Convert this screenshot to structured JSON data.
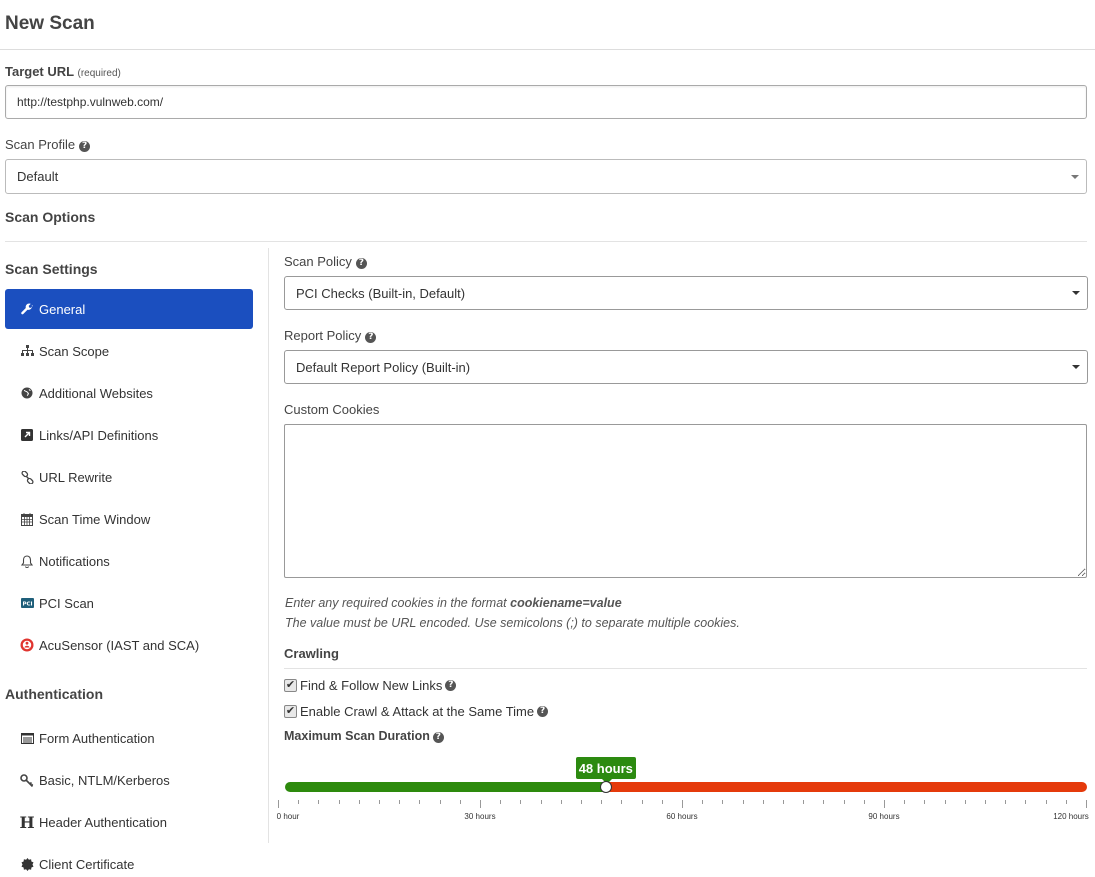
{
  "page": {
    "title": "New Scan"
  },
  "target_url": {
    "label": "Target URL",
    "required": "(required)",
    "value": "http://testphp.vulnweb.com/"
  },
  "scan_profile": {
    "label": "Scan Profile",
    "value": "Default"
  },
  "scan_options": {
    "title": "Scan Options"
  },
  "sidebar": {
    "settings_title": "Scan Settings",
    "items": [
      {
        "label": "General",
        "icon": "wrench-icon",
        "active": true
      },
      {
        "label": "Scan Scope",
        "icon": "sitemap-icon"
      },
      {
        "label": "Additional Websites",
        "icon": "globe-icon"
      },
      {
        "label": "Links/API Definitions",
        "icon": "external-link-icon"
      },
      {
        "label": "URL Rewrite",
        "icon": "link-icon"
      },
      {
        "label": "Scan Time Window",
        "icon": "calendar-icon"
      },
      {
        "label": "Notifications",
        "icon": "bell-icon"
      },
      {
        "label": "PCI Scan",
        "icon": "pci-icon"
      },
      {
        "label": "AcuSensor (IAST and SCA)",
        "icon": "acusensor-icon"
      }
    ],
    "auth_title": "Authentication",
    "auth_items": [
      {
        "label": "Form Authentication",
        "icon": "form-icon"
      },
      {
        "label": "Basic, NTLM/Kerberos",
        "icon": "key-icon"
      },
      {
        "label": "Header Authentication",
        "icon": "header-h-icon"
      },
      {
        "label": "Client Certificate",
        "icon": "certificate-icon"
      }
    ]
  },
  "general": {
    "scan_policy": {
      "label": "Scan Policy",
      "value": "PCI Checks (Built-in, Default)"
    },
    "report_policy": {
      "label": "Report Policy",
      "value": "Default Report Policy (Built-in)"
    },
    "custom_cookies": {
      "label": "Custom Cookies",
      "value": "",
      "hint1_prefix": "Enter any required cookies in the format ",
      "hint1_bold": "cookiename=value",
      "hint2": "The value must be URL encoded. Use semicolons (;) to separate multiple cookies."
    },
    "crawling": {
      "title": "Crawling",
      "find_follow": {
        "label": "Find & Follow New Links",
        "checked": true
      },
      "crawl_attack": {
        "label": "Enable Crawl & Attack at the Same Time",
        "checked": true
      }
    },
    "max_duration": {
      "label": "Maximum Scan Duration",
      "value_hours": 48,
      "value_text": "48 hours",
      "min_hours": 0,
      "max_hours": 120,
      "tick_labels": [
        "0 hour",
        "30 hours",
        "60 hours",
        "90 hours",
        "120 hours"
      ],
      "colors": {
        "below": "#2d8a0d",
        "above": "#e53a0b"
      }
    }
  },
  "colors": {
    "accent": "#1b4fbf",
    "tooltip": "#2c8a10"
  }
}
